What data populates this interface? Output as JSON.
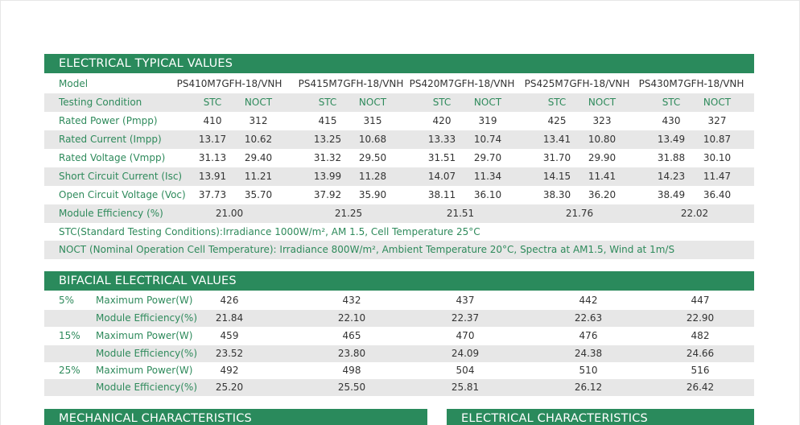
{
  "electrical": {
    "title": "ELECTRICAL TYPICAL VALUES",
    "rows": [
      {
        "label": "Model",
        "values": [
          "PS410M7GFH-18/VNH",
          "PS415M7GFH-18/VNH",
          "PS420M7GFH-18/VNH",
          "PS425M7GFH-18/VNH",
          "PS430M7GFH-18/VNH"
        ]
      },
      {
        "label": "Testing Condition",
        "values": [
          "STC",
          "NOCT",
          "STC",
          "NOCT",
          "STC",
          "NOCT",
          "STC",
          "NOCT",
          "STC",
          "NOCT"
        ]
      },
      {
        "label": "Rated Power (Pmpp)",
        "values": [
          "410",
          "312",
          "415",
          "315",
          "420",
          "319",
          "425",
          "323",
          "430",
          "327"
        ]
      },
      {
        "label": "Rated Current (Impp)",
        "values": [
          "13.17",
          "10.62",
          "13.25",
          "10.68",
          "13.33",
          "10.74",
          "13.41",
          "10.80",
          "13.49",
          "10.87"
        ]
      },
      {
        "label": "Rated Voltage (Vmpp)",
        "values": [
          "31.13",
          "29.40",
          "31.32",
          "29.50",
          "31.51",
          "29.70",
          "31.70",
          "29.90",
          "31.88",
          "30.10"
        ]
      },
      {
        "label": "Short Circuit Current (Isc)",
        "values": [
          "13.91",
          "11.21",
          "13.99",
          "11.28",
          "14.07",
          "11.34",
          "14.15",
          "11.41",
          "14.23",
          "11.47"
        ]
      },
      {
        "label": "Open Circuit Voltage (Voc)",
        "values": [
          "37.73",
          "35.70",
          "37.92",
          "35.90",
          "38.11",
          "36.10",
          "38.30",
          "36.20",
          "38.49",
          "36.40"
        ]
      },
      {
        "label": "Module Efficiency (%)",
        "values": [
          "21.00",
          "21.25",
          "21.51",
          "21.76",
          "22.02"
        ]
      }
    ],
    "stc_note": "STC(Standard Testing Conditions):Irradiance 1000W/m², AM 1.5, Cell Temperature 25°C",
    "noct_note": "NOCT (Nominal Operation Cell Temperature): Irradiance 800W/m², Ambient Temperature 20°C, Spectra at AM1.5, Wind at 1m/S"
  },
  "bifacial": {
    "title": "BIFACIAL ELECTRICAL VALUES",
    "power_label": "Maximum Power(W)",
    "efficiency_label": "Module Efficiency(%)",
    "groups": [
      {
        "percent": "5%",
        "power": [
          "426",
          "432",
          "437",
          "442",
          "447"
        ],
        "efficiency": [
          "21.84",
          "22.10",
          "22.37",
          "22.63",
          "22.90"
        ]
      },
      {
        "percent": "15%",
        "power": [
          "459",
          "465",
          "470",
          "476",
          "482"
        ],
        "efficiency": [
          "23.52",
          "23.80",
          "24.09",
          "24.38",
          "24.66"
        ]
      },
      {
        "percent": "25%",
        "power": [
          "492",
          "498",
          "504",
          "510",
          "516"
        ],
        "efficiency": [
          "25.20",
          "25.50",
          "25.81",
          "26.12",
          "26.42"
        ]
      }
    ]
  },
  "mechanical": {
    "title": "MECHANICAL CHARACTERISTICS"
  },
  "electrical_characteristics": {
    "title": "ELECTRICAL CHARACTERISTICS"
  }
}
